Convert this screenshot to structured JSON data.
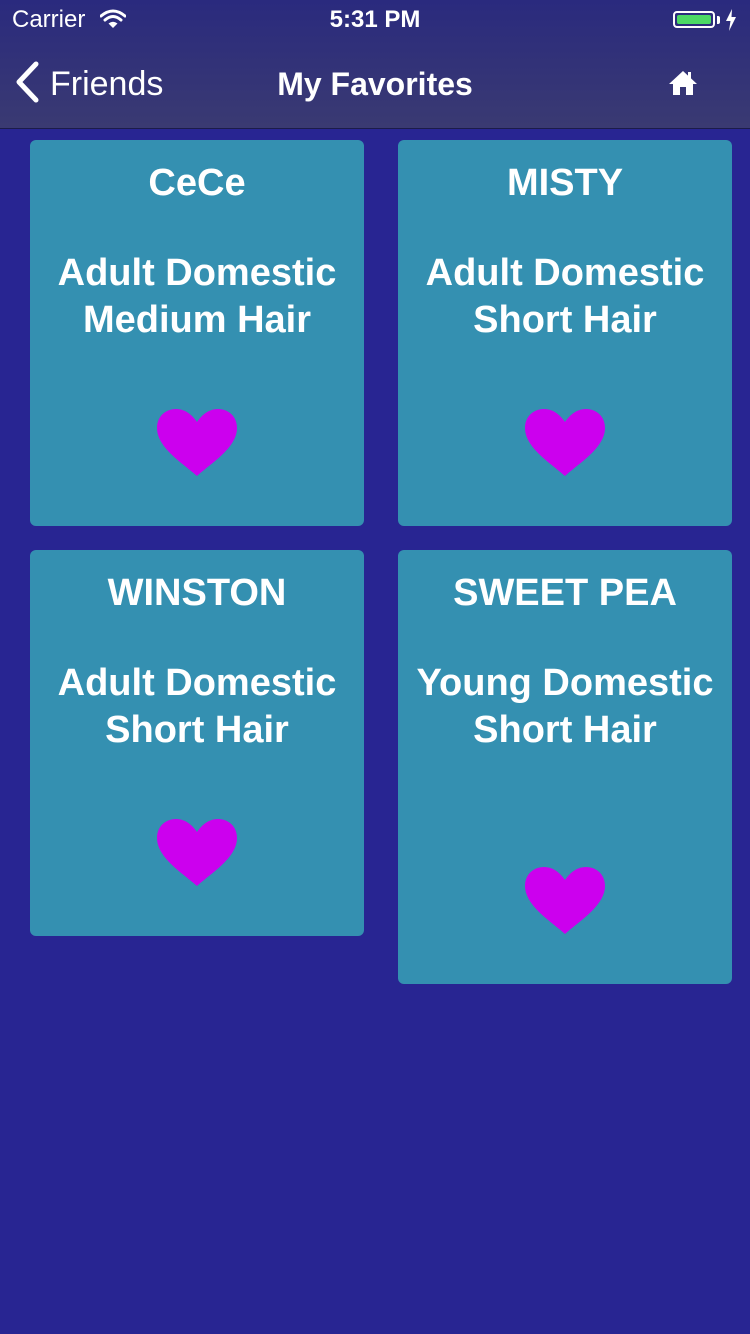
{
  "status_bar": {
    "carrier": "Carrier",
    "time": "5:31 PM",
    "battery_color": "#4cd964",
    "battery_level": 1.0
  },
  "nav": {
    "back_label": "Friends",
    "title": "My Favorites"
  },
  "colors": {
    "background": "#282592",
    "card": "#3490b1",
    "heart": "#cc00ee"
  },
  "favorites": [
    {
      "name": "CeCe",
      "description": "Adult Domestic Medium Hair"
    },
    {
      "name": "MISTY",
      "description": "Adult Domestic Short Hair"
    },
    {
      "name": "WINSTON",
      "description": "Adult Domestic Short Hair"
    },
    {
      "name": "SWEET PEA",
      "description": "Young Domestic Short Hair"
    }
  ]
}
